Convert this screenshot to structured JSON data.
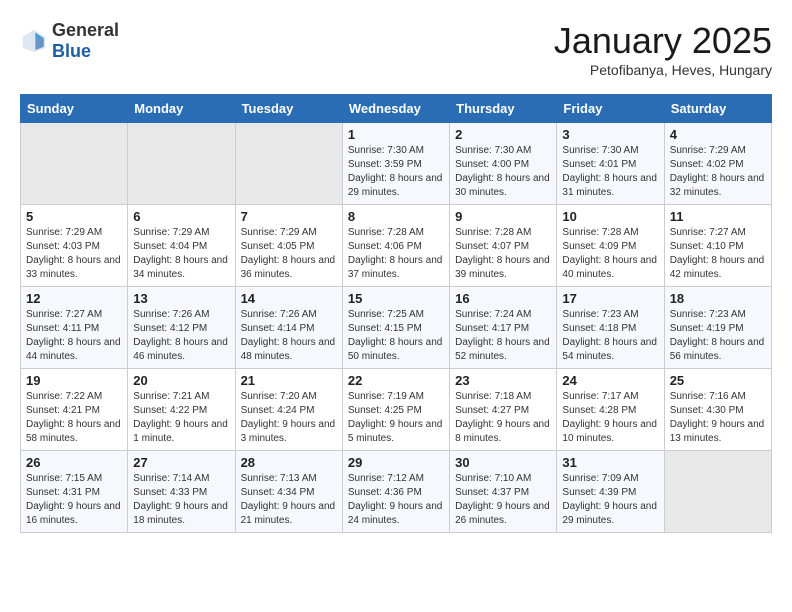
{
  "header": {
    "logo_general": "General",
    "logo_blue": "Blue",
    "month_title": "January 2025",
    "subtitle": "Petofibanya, Heves, Hungary"
  },
  "days_of_week": [
    "Sunday",
    "Monday",
    "Tuesday",
    "Wednesday",
    "Thursday",
    "Friday",
    "Saturday"
  ],
  "weeks": [
    [
      {
        "day": "",
        "content": ""
      },
      {
        "day": "",
        "content": ""
      },
      {
        "day": "",
        "content": ""
      },
      {
        "day": "1",
        "content": "Sunrise: 7:30 AM\nSunset: 3:59 PM\nDaylight: 8 hours and 29 minutes."
      },
      {
        "day": "2",
        "content": "Sunrise: 7:30 AM\nSunset: 4:00 PM\nDaylight: 8 hours and 30 minutes."
      },
      {
        "day": "3",
        "content": "Sunrise: 7:30 AM\nSunset: 4:01 PM\nDaylight: 8 hours and 31 minutes."
      },
      {
        "day": "4",
        "content": "Sunrise: 7:29 AM\nSunset: 4:02 PM\nDaylight: 8 hours and 32 minutes."
      }
    ],
    [
      {
        "day": "5",
        "content": "Sunrise: 7:29 AM\nSunset: 4:03 PM\nDaylight: 8 hours and 33 minutes."
      },
      {
        "day": "6",
        "content": "Sunrise: 7:29 AM\nSunset: 4:04 PM\nDaylight: 8 hours and 34 minutes."
      },
      {
        "day": "7",
        "content": "Sunrise: 7:29 AM\nSunset: 4:05 PM\nDaylight: 8 hours and 36 minutes."
      },
      {
        "day": "8",
        "content": "Sunrise: 7:28 AM\nSunset: 4:06 PM\nDaylight: 8 hours and 37 minutes."
      },
      {
        "day": "9",
        "content": "Sunrise: 7:28 AM\nSunset: 4:07 PM\nDaylight: 8 hours and 39 minutes."
      },
      {
        "day": "10",
        "content": "Sunrise: 7:28 AM\nSunset: 4:09 PM\nDaylight: 8 hours and 40 minutes."
      },
      {
        "day": "11",
        "content": "Sunrise: 7:27 AM\nSunset: 4:10 PM\nDaylight: 8 hours and 42 minutes."
      }
    ],
    [
      {
        "day": "12",
        "content": "Sunrise: 7:27 AM\nSunset: 4:11 PM\nDaylight: 8 hours and 44 minutes."
      },
      {
        "day": "13",
        "content": "Sunrise: 7:26 AM\nSunset: 4:12 PM\nDaylight: 8 hours and 46 minutes."
      },
      {
        "day": "14",
        "content": "Sunrise: 7:26 AM\nSunset: 4:14 PM\nDaylight: 8 hours and 48 minutes."
      },
      {
        "day": "15",
        "content": "Sunrise: 7:25 AM\nSunset: 4:15 PM\nDaylight: 8 hours and 50 minutes."
      },
      {
        "day": "16",
        "content": "Sunrise: 7:24 AM\nSunset: 4:17 PM\nDaylight: 8 hours and 52 minutes."
      },
      {
        "day": "17",
        "content": "Sunrise: 7:23 AM\nSunset: 4:18 PM\nDaylight: 8 hours and 54 minutes."
      },
      {
        "day": "18",
        "content": "Sunrise: 7:23 AM\nSunset: 4:19 PM\nDaylight: 8 hours and 56 minutes."
      }
    ],
    [
      {
        "day": "19",
        "content": "Sunrise: 7:22 AM\nSunset: 4:21 PM\nDaylight: 8 hours and 58 minutes."
      },
      {
        "day": "20",
        "content": "Sunrise: 7:21 AM\nSunset: 4:22 PM\nDaylight: 9 hours and 1 minute."
      },
      {
        "day": "21",
        "content": "Sunrise: 7:20 AM\nSunset: 4:24 PM\nDaylight: 9 hours and 3 minutes."
      },
      {
        "day": "22",
        "content": "Sunrise: 7:19 AM\nSunset: 4:25 PM\nDaylight: 9 hours and 5 minutes."
      },
      {
        "day": "23",
        "content": "Sunrise: 7:18 AM\nSunset: 4:27 PM\nDaylight: 9 hours and 8 minutes."
      },
      {
        "day": "24",
        "content": "Sunrise: 7:17 AM\nSunset: 4:28 PM\nDaylight: 9 hours and 10 minutes."
      },
      {
        "day": "25",
        "content": "Sunrise: 7:16 AM\nSunset: 4:30 PM\nDaylight: 9 hours and 13 minutes."
      }
    ],
    [
      {
        "day": "26",
        "content": "Sunrise: 7:15 AM\nSunset: 4:31 PM\nDaylight: 9 hours and 16 minutes."
      },
      {
        "day": "27",
        "content": "Sunrise: 7:14 AM\nSunset: 4:33 PM\nDaylight: 9 hours and 18 minutes."
      },
      {
        "day": "28",
        "content": "Sunrise: 7:13 AM\nSunset: 4:34 PM\nDaylight: 9 hours and 21 minutes."
      },
      {
        "day": "29",
        "content": "Sunrise: 7:12 AM\nSunset: 4:36 PM\nDaylight: 9 hours and 24 minutes."
      },
      {
        "day": "30",
        "content": "Sunrise: 7:10 AM\nSunset: 4:37 PM\nDaylight: 9 hours and 26 minutes."
      },
      {
        "day": "31",
        "content": "Sunrise: 7:09 AM\nSunset: 4:39 PM\nDaylight: 9 hours and 29 minutes."
      },
      {
        "day": "",
        "content": ""
      }
    ]
  ]
}
